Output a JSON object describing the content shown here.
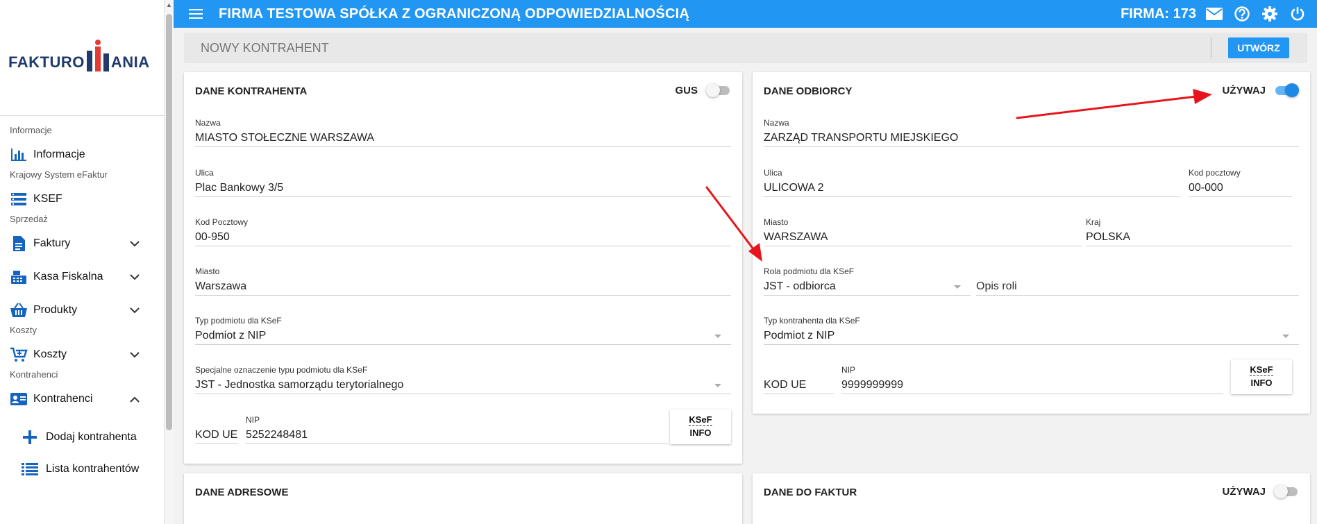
{
  "app": {
    "logo": "FAKTUROMANIA",
    "logo_left": "FAKTURO",
    "logo_right": "ANIA",
    "title": "FIRMA TESTOWA SPÓŁKA Z OGRANICZONĄ ODPOWIEDZIALNOŚCIĄ",
    "firma": "FIRMA: 173"
  },
  "sidebar": {
    "sec_info": "Informacje",
    "item_info": "Informacje",
    "sec_ksef": "Krajowy System eFaktur",
    "item_ksef": "KSEF",
    "sec_sprzedaz": "Sprzedaż",
    "item_faktury": "Faktury",
    "item_kasa": "Kasa Fiskalna",
    "item_produkty": "Produkty",
    "sec_koszty": "Koszty",
    "item_koszty": "Koszty",
    "sec_kontrahenci": "Kontrahenci",
    "item_kontrahenci": "Kontrahenci",
    "sub_dodaj": "Dodaj kontrahenta",
    "sub_lista": "Lista kontrahentów"
  },
  "createbar": {
    "name": "NOWY KONTRAHENT",
    "button": "UTWÓRZ"
  },
  "kontrahent": {
    "title": "DANE KONTRAHENTA",
    "gus_label": "GUS",
    "gus_on": false,
    "nazwa_label": "Nazwa",
    "nazwa": "MIASTO STOŁECZNE WARSZAWA",
    "ulica_label": "Ulica",
    "ulica": "Plac Bankowy 3/5",
    "kod_label": "Kod Pocztowy",
    "kod": "00-950",
    "miasto_label": "Miasto",
    "miasto": "Warszawa",
    "typ_label": "Typ podmiotu dla KSeF",
    "typ": "Podmiot z NIP",
    "spec_label": "Specjalne oznaczenie typu podmiotu dla KSeF",
    "spec": "JST - Jednostka samorządu terytorialnego",
    "kod_ue": "KOD UE",
    "nip_label": "NIP",
    "nip": "5252248481",
    "ksef_1": "KSeF",
    "ksef_2": "INFO"
  },
  "odbiorca": {
    "title": "DANE ODBIORCY",
    "uzywaj_label": "UŻYWAJ",
    "uzywaj_on": true,
    "nazwa_label": "Nazwa",
    "nazwa": "ZARZĄD TRANSPORTU MIEJSKIEGO",
    "ulica_label": "Ulica",
    "ulica": "ULICOWA 2",
    "kod_label": "Kod pocztowy",
    "kod": "00-000",
    "miasto_label": "Miasto",
    "miasto": "WARSZAWA",
    "kraj_label": "Kraj",
    "kraj": "POLSKA",
    "rola_label": "Rola podmiotu dla KSeF",
    "rola": "JST - odbiorca",
    "opis_placeholder": "Opis roli",
    "typ_label": "Typ kontrahenta dla KSeF",
    "typ": "Podmiot z NIP",
    "kod_ue": "KOD UE",
    "nip_label": "NIP",
    "nip": "9999999999",
    "ksef_1": "KSeF",
    "ksef_2": "INFO"
  },
  "adresowe": {
    "title": "DANE ADRESOWE"
  },
  "faktur": {
    "title": "DANE DO FAKTUR",
    "uzywaj_label": "UŻYWAJ",
    "uzywaj_on": false
  },
  "colors": {
    "topbar": "#2196f3",
    "accent": "#1565c0",
    "arrow": "#e8141b"
  }
}
